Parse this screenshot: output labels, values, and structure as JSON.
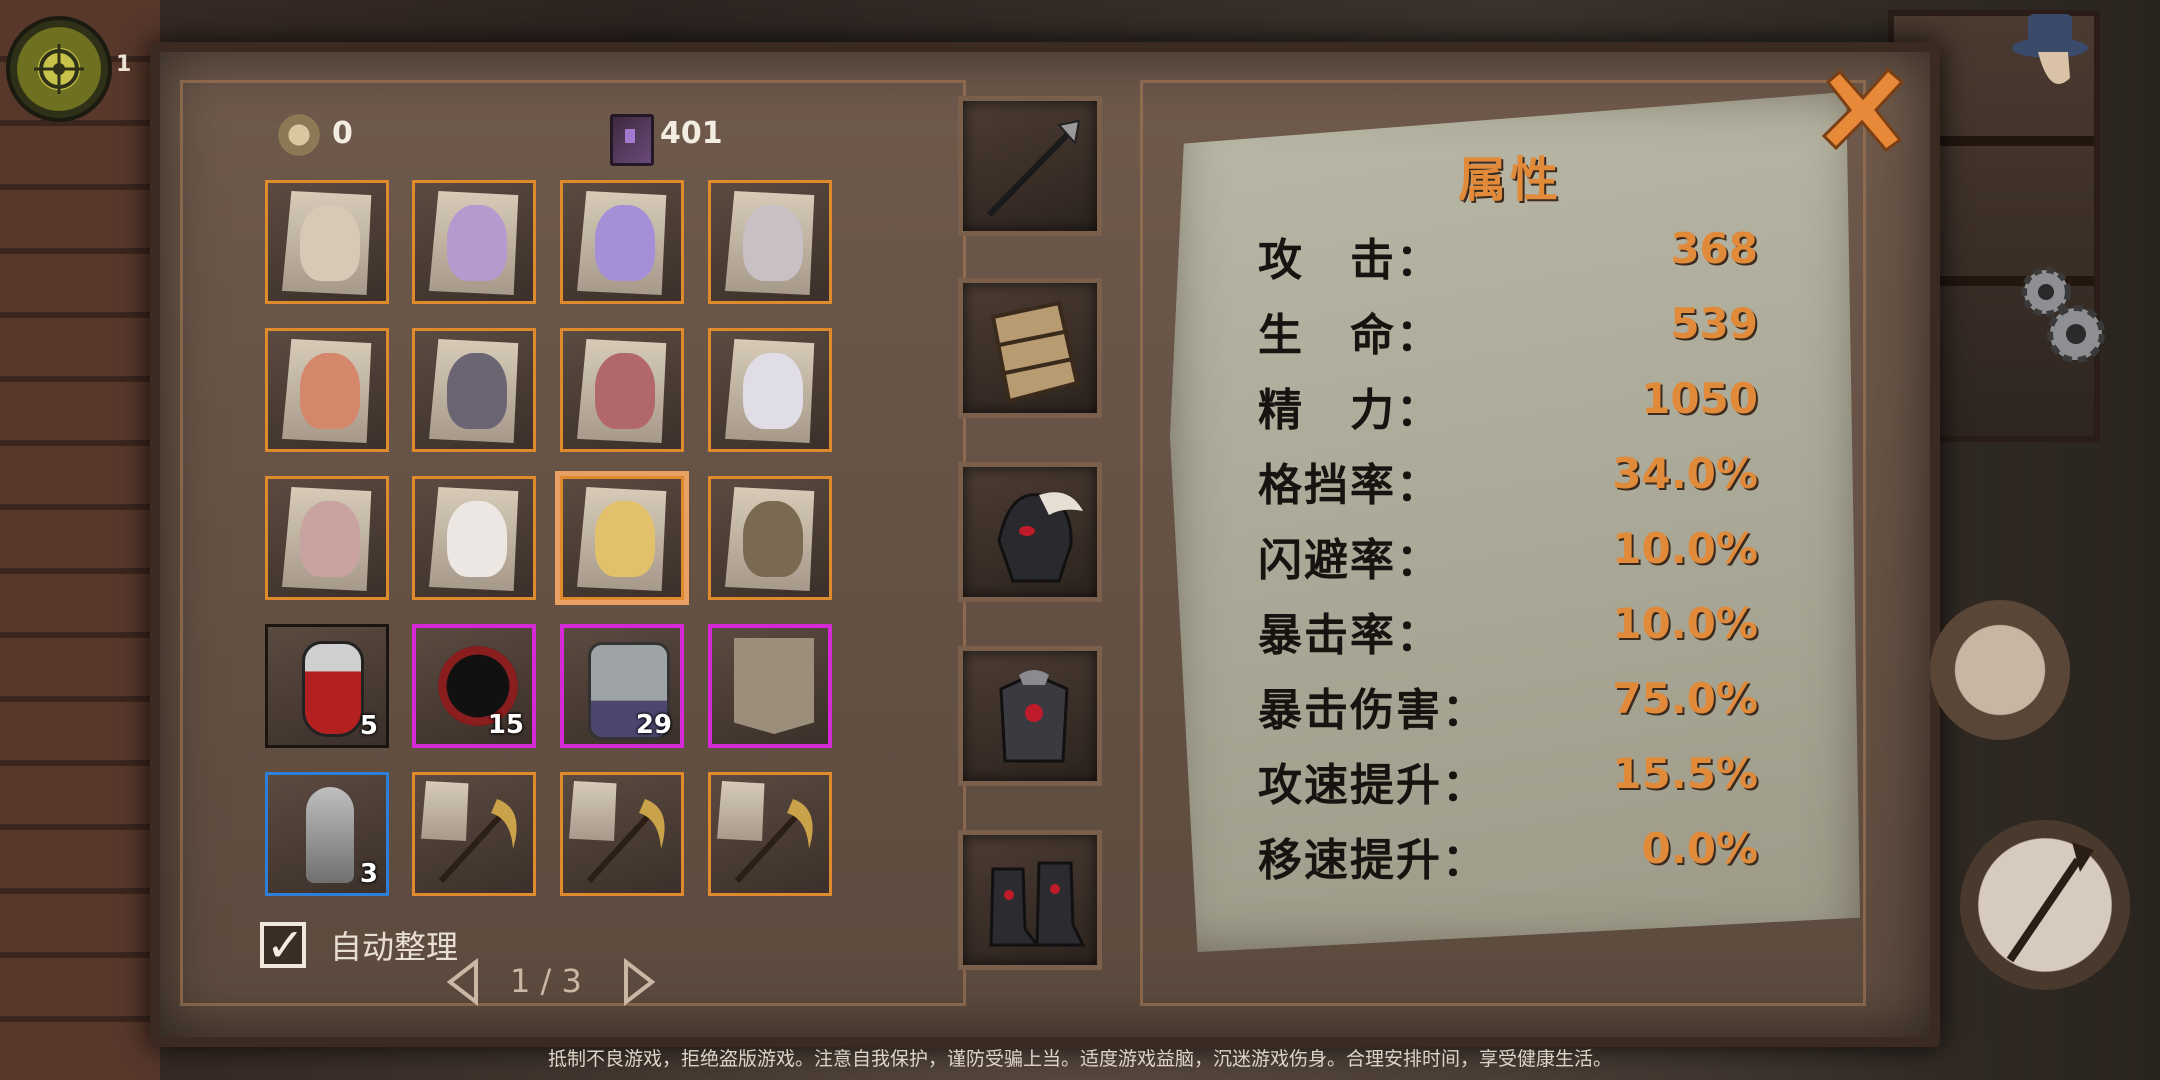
{
  "player": {
    "level": "1"
  },
  "currencies": {
    "coins": "0",
    "books": "401"
  },
  "inventory": {
    "slots": [
      {
        "type": "hero",
        "rarity": "orange"
      },
      {
        "type": "hero",
        "rarity": "orange"
      },
      {
        "type": "hero",
        "rarity": "orange"
      },
      {
        "type": "hero",
        "rarity": "orange"
      },
      {
        "type": "hero",
        "rarity": "orange"
      },
      {
        "type": "hero",
        "rarity": "orange"
      },
      {
        "type": "hero",
        "rarity": "orange"
      },
      {
        "type": "hero",
        "rarity": "orange"
      },
      {
        "type": "hero",
        "rarity": "orange"
      },
      {
        "type": "hero",
        "rarity": "orange"
      },
      {
        "type": "hero",
        "rarity": "orange",
        "selected": true
      },
      {
        "type": "hero",
        "rarity": "orange"
      },
      {
        "type": "potion",
        "rarity": "dark",
        "count": "5"
      },
      {
        "type": "orb",
        "rarity": "purple",
        "count": "15"
      },
      {
        "type": "jar",
        "rarity": "purple",
        "count": "29"
      },
      {
        "type": "banner",
        "rarity": "purple"
      },
      {
        "type": "statue",
        "rarity": "blue",
        "count": "3"
      },
      {
        "type": "weapon",
        "rarity": "orange"
      },
      {
        "type": "weapon",
        "rarity": "orange"
      },
      {
        "type": "weapon",
        "rarity": "orange"
      }
    ],
    "auto_sort_label": "自动整理",
    "auto_sort_checked": true,
    "checkmark": "✓",
    "page": "1 / 3"
  },
  "equipment": [
    "spear",
    "shield",
    "helmet",
    "armor",
    "boots"
  ],
  "attributes": {
    "title": "属性",
    "rows": [
      {
        "label": "攻　击：",
        "value": "368"
      },
      {
        "label": "生　命：",
        "value": "539"
      },
      {
        "label": "精　力：",
        "value": "1050"
      },
      {
        "label": "格挡率：",
        "value": "34.0%"
      },
      {
        "label": "闪避率：",
        "value": "10.0%"
      },
      {
        "label": "暴击率：",
        "value": "10.0%"
      },
      {
        "label": "暴击伤害：",
        "value": "75.0%"
      },
      {
        "label": "攻速提升：",
        "value": "15.5%"
      },
      {
        "label": "移速提升：",
        "value": "0.0%"
      }
    ]
  },
  "footer": "抵制不良游戏，拒绝盗版游戏。注意自我保护，谨防受骗上当。适度游戏益脑，沉迷游戏伤身。合理安排时间，享受健康生活。",
  "colors": {
    "accent": "#e08a3a",
    "rare_purple": "#d629d6",
    "rare_orange": "#e08a2e",
    "rare_blue": "#2d7fd8"
  }
}
